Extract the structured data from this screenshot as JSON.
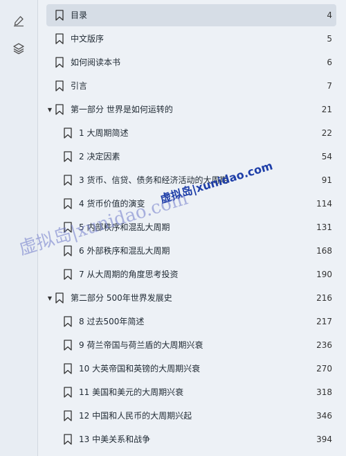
{
  "rail": {
    "items": [
      {
        "icon": "pen-icon"
      },
      {
        "icon": "layers-icon"
      }
    ]
  },
  "toc": [
    {
      "title": "目录",
      "page": "4",
      "level": 0,
      "active": true
    },
    {
      "title": "中文版序",
      "page": "5",
      "level": 0
    },
    {
      "title": "如何阅读本书",
      "page": "6",
      "level": 0
    },
    {
      "title": "引言",
      "page": "7",
      "level": 0
    },
    {
      "title": "第一部分 世界是如何运转的",
      "page": "21",
      "level": 0,
      "expandable": true
    },
    {
      "title": "1 大周期简述",
      "page": "22",
      "level": 1
    },
    {
      "title": "2 决定因素",
      "page": "54",
      "level": 1
    },
    {
      "title": "3 货币、信贷、债务和经济活动的大周期",
      "page": "91",
      "level": 1
    },
    {
      "title": "4 货币价值的演变",
      "page": "114",
      "level": 1
    },
    {
      "title": "5 内部秩序和混乱大周期",
      "page": "131",
      "level": 1
    },
    {
      "title": "6 外部秩序和混乱大周期",
      "page": "168",
      "level": 1
    },
    {
      "title": "7 从大周期的角度思考投资",
      "page": "190",
      "level": 1
    },
    {
      "title": "第二部分 500年世界发展史",
      "page": "216",
      "level": 0,
      "expandable": true
    },
    {
      "title": "8 过去500年简述",
      "page": "217",
      "level": 1
    },
    {
      "title": "9 荷兰帝国与荷兰盾的大周期兴衰",
      "page": "236",
      "level": 1
    },
    {
      "title": "10 大英帝国和英镑的大周期兴衰",
      "page": "270",
      "level": 1
    },
    {
      "title": "11 美国和美元的大周期兴衰",
      "page": "318",
      "level": 1
    },
    {
      "title": "12 中国和人民币的大周期兴起",
      "page": "346",
      "level": 1
    },
    {
      "title": "13 中美关系和战争",
      "page": "394",
      "level": 1
    }
  ],
  "watermark": {
    "small": "虚拟岛|xunidao.com",
    "large": "虚拟岛|xunidao.com"
  }
}
